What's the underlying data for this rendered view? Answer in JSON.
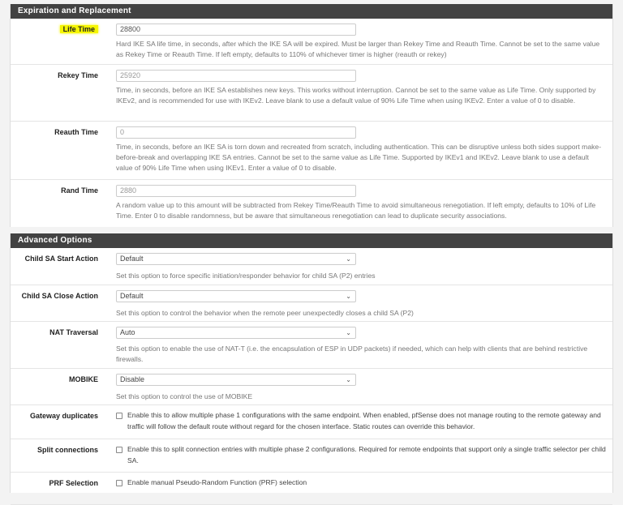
{
  "sections": [
    {
      "title": "Expiration and Replacement",
      "rows": [
        {
          "label": "Life Time",
          "value": "28800",
          "help": "Hard IKE SA life time, in seconds, after which the IKE SA will be expired. Must be larger than Rekey Time and Reauth Time. Cannot be set to the same value as Rekey Time or Reauth Time. If left empty, defaults to 110% of whichever timer is higher (reauth or rekey)"
        },
        {
          "label": "Rekey Time",
          "placeholder": "25920",
          "help": "Time, in seconds, before an IKE SA establishes new keys. This works without interruption. Cannot be set to the same value as Life Time. Only supported by IKEv2, and is recommended for use with IKEv2. Leave blank to use a default value of 90% Life Time when using IKEv2. Enter a value of 0 to disable."
        },
        {
          "label": "Reauth Time",
          "placeholder": "0",
          "help": "Time, in seconds, before an IKE SA is torn down and recreated from scratch, including authentication. This can be disruptive unless both sides support make-before-break and overlapping IKE SA entries. Cannot be set to the same value as Life Time. Supported by IKEv1 and IKEv2. Leave blank to use a default value of 90% Life Time when using IKEv1. Enter a value of 0 to disable."
        },
        {
          "label": "Rand Time",
          "placeholder": "2880",
          "help": "A random value up to this amount will be subtracted from Rekey Time/Reauth Time to avoid simultaneous renegotiation. If left empty, defaults to 10% of Life Time. Enter 0 to disable randomness, but be aware that simultaneous renegotiation can lead to duplicate security associations."
        }
      ]
    },
    {
      "title": "Advanced Options",
      "rows": [
        {
          "label": "Child SA Start Action",
          "selected": "Default",
          "help": "Set this option to force specific initiation/responder behavior for child SA (P2) entries"
        },
        {
          "label": "Child SA Close Action",
          "selected": "Default",
          "help": "Set this option to control the behavior when the remote peer unexpectedly closes a child SA (P2)"
        },
        {
          "label": "NAT Traversal",
          "selected": "Auto",
          "help": "Set this option to enable the use of NAT-T (i.e. the encapsulation of ESP in UDP packets) if needed, which can help with clients that are behind restrictive firewalls."
        },
        {
          "label": "MOBIKE",
          "selected": "Disable",
          "help": "Set this option to control the use of MOBIKE"
        },
        {
          "label": "Gateway duplicates",
          "checked": false,
          "text": "Enable this to allow multiple phase 1 configurations with the same endpoint. When enabled, pfSense does not manage routing to the remote gateway and traffic will follow the default route without regard for the chosen interface. Static routes can override this behavior."
        },
        {
          "label": "Split connections",
          "checked": false,
          "text": "Enable this to split connection entries with multiple phase 2 configurations. Required for remote endpoints that support only a single traffic selector per child SA."
        },
        {
          "label": "PRF Selection",
          "checked": false,
          "text": "Enable manual Pseudo-Random Function (PRF) selection"
        }
      ]
    }
  ],
  "colors": {
    "header": "#424242",
    "highlight": "#f5f500"
  }
}
